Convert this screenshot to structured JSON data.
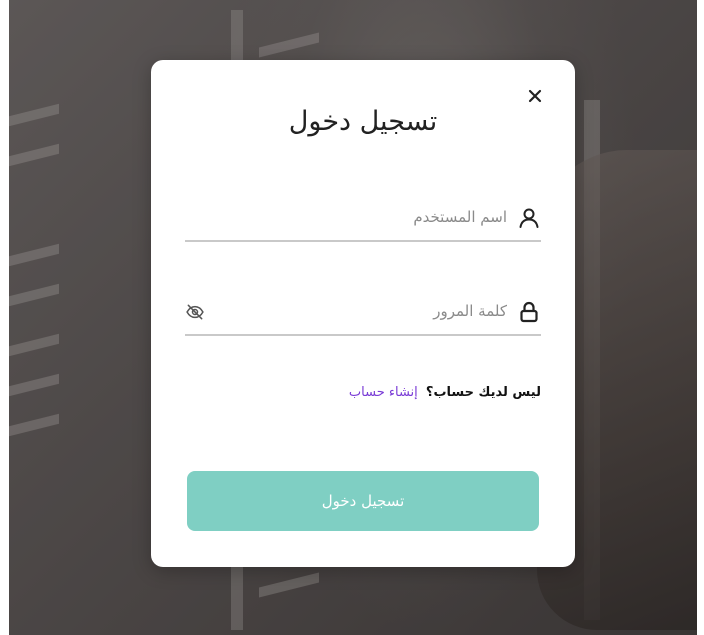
{
  "modal": {
    "title": "تسجيل دخول",
    "close_icon": "close-icon",
    "username": {
      "placeholder": "اسم المستخدم",
      "value": "",
      "icon": "user-icon"
    },
    "password": {
      "placeholder": "كلمة المرور",
      "value": "",
      "icon": "lock-icon",
      "toggle_icon": "eye-off-icon"
    },
    "signup": {
      "question": "ليس لديك حساب؟",
      "link": "إنشاء حساب",
      "link_color": "#7a3cd6"
    },
    "submit_label": "تسجيل دخول",
    "submit_color": "#7fcfc3"
  }
}
